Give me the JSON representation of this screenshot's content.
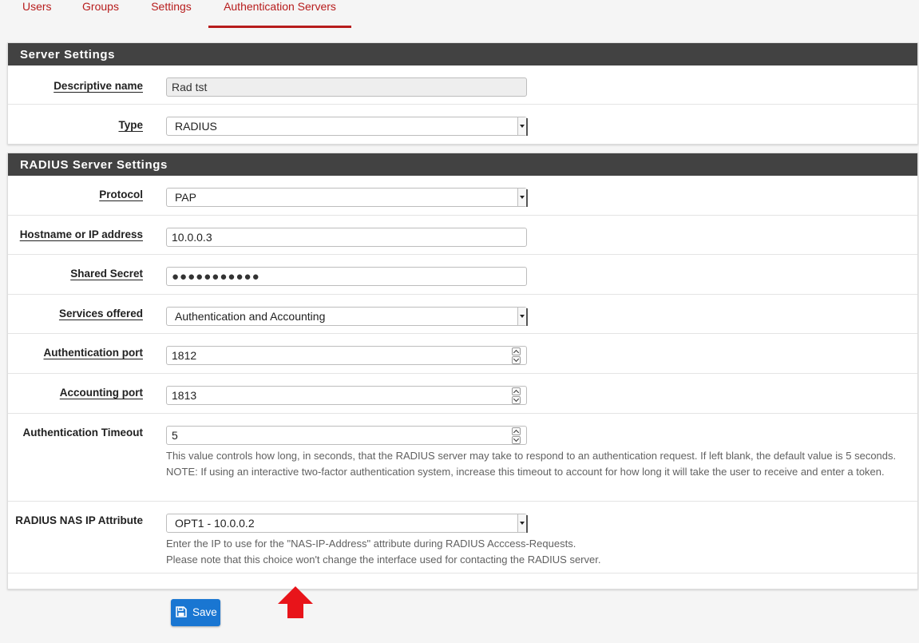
{
  "tabs": [
    {
      "label": "Users"
    },
    {
      "label": "Groups"
    },
    {
      "label": "Settings"
    },
    {
      "label": "Authentication Servers",
      "active": true
    }
  ],
  "server_settings": {
    "heading": "Server Settings",
    "descriptive_name": {
      "label": "Descriptive name",
      "value": "Rad tst"
    },
    "type": {
      "label": "Type",
      "value": "RADIUS"
    }
  },
  "radius_settings": {
    "heading": "RADIUS Server Settings",
    "protocol": {
      "label": "Protocol",
      "value": "PAP"
    },
    "hostname": {
      "label": "Hostname or IP address",
      "value": "10.0.0.3"
    },
    "shared_secret": {
      "label": "Shared Secret",
      "value": "●●●●●●●●●●●"
    },
    "services": {
      "label": "Services offered",
      "value": "Authentication and Accounting"
    },
    "auth_port": {
      "label": "Authentication port",
      "value": "1812"
    },
    "acct_port": {
      "label": "Accounting port",
      "value": "1813"
    },
    "timeout": {
      "label": "Authentication Timeout",
      "value": "5",
      "help": "This value controls how long, in seconds, that the RADIUS server may take to respond to an authentication request. If left blank, the default value is 5 seconds. NOTE: If using an interactive two-factor authentication system, increase this timeout to account for how long it will take the user to receive and enter a token."
    },
    "nas_ip": {
      "label": "RADIUS NAS IP Attribute",
      "value": "OPT1 - 10.0.0.2",
      "help_line1": "Enter the IP to use for the \"NAS-IP-Address\" attribute during RADIUS Acccess-Requests.",
      "help_line2": "Please note that this choice won't change the interface used for contacting the RADIUS server."
    }
  },
  "save_button": {
    "label": "Save"
  },
  "colors": {
    "accent": "#b71c1c",
    "heading_bg": "#424242",
    "primary": "#1976d2",
    "annotation_arrow": "#e8141a"
  },
  "icons": {
    "save": "floppy-disk-icon",
    "annotation": "red-up-arrow"
  }
}
